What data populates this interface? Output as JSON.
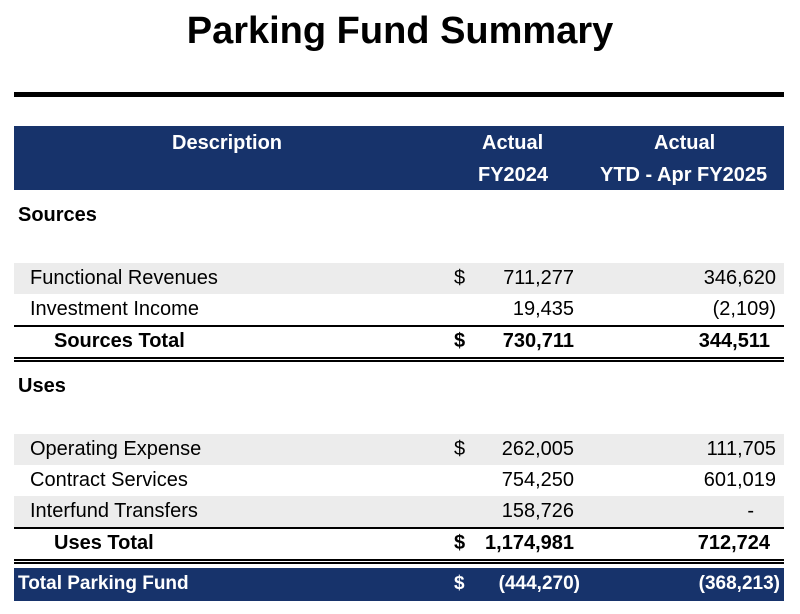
{
  "title": "Parking Fund Summary",
  "header": {
    "description": "Description",
    "col1_line1": "Actual",
    "col1_line2": "FY2024",
    "col2_line1": "Actual",
    "col2_line2": "YTD - Apr FY2025"
  },
  "sources": {
    "label": "Sources",
    "rows": [
      {
        "description": "Functional Revenues",
        "dollar": "$",
        "fy2024": "711,277",
        "ytd": "346,620"
      },
      {
        "description": "Investment Income",
        "dollar": "",
        "fy2024": "19,435",
        "ytd": "(2,109)"
      }
    ],
    "total": {
      "description": "Sources Total",
      "dollar": "$",
      "fy2024": "730,711",
      "ytd": "344,511"
    }
  },
  "uses": {
    "label": "Uses",
    "rows": [
      {
        "description": "Operating Expense",
        "dollar": "$",
        "fy2024": "262,005",
        "ytd": "111,705"
      },
      {
        "description": "Contract Services",
        "dollar": "",
        "fy2024": "754,250",
        "ytd": "601,019"
      },
      {
        "description": "Interfund Transfers",
        "dollar": "",
        "fy2024": "158,726",
        "ytd": "-"
      }
    ],
    "total": {
      "description": "Uses Total",
      "dollar": "$",
      "fy2024": "1,174,981",
      "ytd": "712,724"
    }
  },
  "grand_total": {
    "description": "Total Parking Fund",
    "dollar": "$",
    "fy2024": "(444,270)",
    "ytd": "(368,213)"
  },
  "colors": {
    "header_bg": "#17336b",
    "row_shade": "#ececec"
  }
}
